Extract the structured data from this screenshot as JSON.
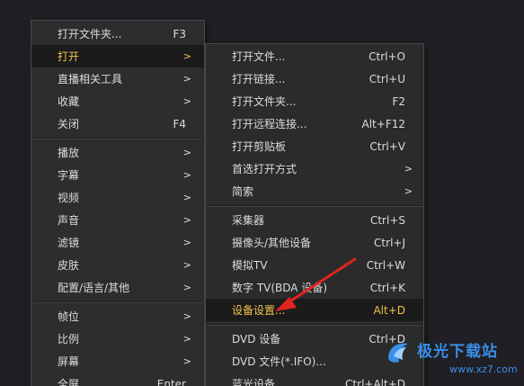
{
  "main_menu": [
    {
      "label": "打开文件夹...",
      "shortcut": "F3",
      "arrow": ""
    },
    {
      "label": "打开",
      "shortcut": "",
      "arrow": ">"
    },
    {
      "label": "直播相关工具",
      "shortcut": "",
      "arrow": ">"
    },
    {
      "label": "收藏",
      "shortcut": "",
      "arrow": ">"
    },
    {
      "label": "关闭",
      "shortcut": "F4",
      "arrow": ""
    },
    {
      "label": "播放",
      "shortcut": "",
      "arrow": ">"
    },
    {
      "label": "字幕",
      "shortcut": "",
      "arrow": ">"
    },
    {
      "label": "视频",
      "shortcut": "",
      "arrow": ">"
    },
    {
      "label": "声音",
      "shortcut": "",
      "arrow": ">"
    },
    {
      "label": "滤镜",
      "shortcut": "",
      "arrow": ">"
    },
    {
      "label": "皮肤",
      "shortcut": "",
      "arrow": ">"
    },
    {
      "label": "配置/语言/其他",
      "shortcut": "",
      "arrow": ">"
    },
    {
      "label": "帧位",
      "shortcut": "",
      "arrow": ">"
    },
    {
      "label": "比例",
      "shortcut": "",
      "arrow": ">"
    },
    {
      "label": "屏幕",
      "shortcut": "",
      "arrow": ">"
    },
    {
      "label": "全屏",
      "shortcut": "Enter",
      "arrow": ""
    }
  ],
  "sub_menu": [
    {
      "label": "打开文件...",
      "shortcut": "Ctrl+O",
      "arrow": ""
    },
    {
      "label": "打开链接...",
      "shortcut": "Ctrl+U",
      "arrow": ""
    },
    {
      "label": "打开文件夹...",
      "shortcut": "F2",
      "arrow": ""
    },
    {
      "label": "打开远程连接...",
      "shortcut": "Alt+F12",
      "arrow": ""
    },
    {
      "label": "打开剪贴板",
      "shortcut": "Ctrl+V",
      "arrow": ""
    },
    {
      "label": "首选打开方式",
      "shortcut": "",
      "arrow": ">"
    },
    {
      "label": "简索",
      "shortcut": "",
      "arrow": ">"
    },
    {
      "label": "采集器",
      "shortcut": "Ctrl+S",
      "arrow": ""
    },
    {
      "label": "摄像头/其他设备",
      "shortcut": "Ctrl+J",
      "arrow": ""
    },
    {
      "label": "模拟TV",
      "shortcut": "Ctrl+W",
      "arrow": ""
    },
    {
      "label": "数字 TV(BDA 设备)",
      "shortcut": "Ctrl+K",
      "arrow": ""
    },
    {
      "label": "设备设置...",
      "shortcut": "Alt+D",
      "arrow": ""
    },
    {
      "label": "DVD 设备",
      "shortcut": "Ctrl+D",
      "arrow": ""
    },
    {
      "label": "DVD 文件(*.IFO)...",
      "shortcut": "",
      "arrow": ""
    },
    {
      "label": "蓝光设备",
      "shortcut": "Ctrl+Alt+D",
      "arrow": ""
    }
  ],
  "watermark": {
    "title": "极光下载站",
    "url": "www.xz7.com"
  },
  "colors": {
    "highlight_text": "#f0c24a",
    "arrow": "#e0241f",
    "watermark": "#3a8fe6"
  }
}
